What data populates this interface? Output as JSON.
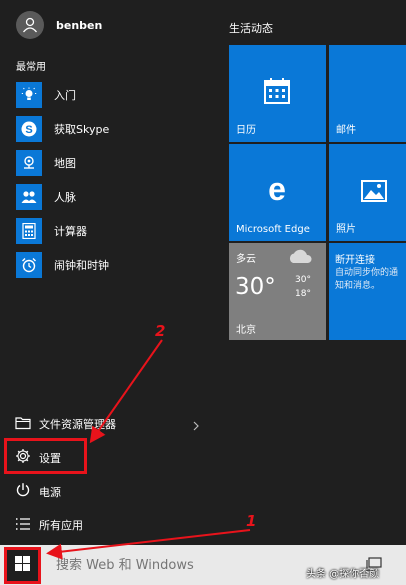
{
  "user": {
    "name": "benben"
  },
  "most_used": {
    "header": "最常用",
    "items": [
      {
        "label": "入门",
        "icon": "lightbulb-icon"
      },
      {
        "label": "获取Skype",
        "icon": "skype-icon"
      },
      {
        "label": "地图",
        "icon": "map-icon"
      },
      {
        "label": "人脉",
        "icon": "people-icon"
      },
      {
        "label": "计算器",
        "icon": "calculator-icon"
      },
      {
        "label": "闹钟和时钟",
        "icon": "alarm-clock-icon"
      }
    ]
  },
  "system": {
    "file_explorer": "文件资源管理器",
    "settings": "设置",
    "power": "电源",
    "all_apps": "所有应用"
  },
  "tiles": {
    "header": "生活动态",
    "calendar": "日历",
    "mail": "邮件",
    "edge": "Microsoft Edge",
    "photos": "照片",
    "weather": {
      "condition": "多云",
      "temp": "30°",
      "high": "30°",
      "low": "18°",
      "city": "北京"
    },
    "sync": {
      "title": "断开连接",
      "message": "自动同步你的通知和消息。"
    }
  },
  "taskbar": {
    "search_placeholder": "搜索 Web 和 Windows",
    "watermark": "头条 @探你否颜"
  },
  "annotations": {
    "one": "1",
    "two": "2"
  },
  "colors": {
    "tile": "#0a78d7",
    "menu_bg": "#1f1f1f",
    "highlight": "#e8131b",
    "weather_tile": "#7f7f7f"
  }
}
